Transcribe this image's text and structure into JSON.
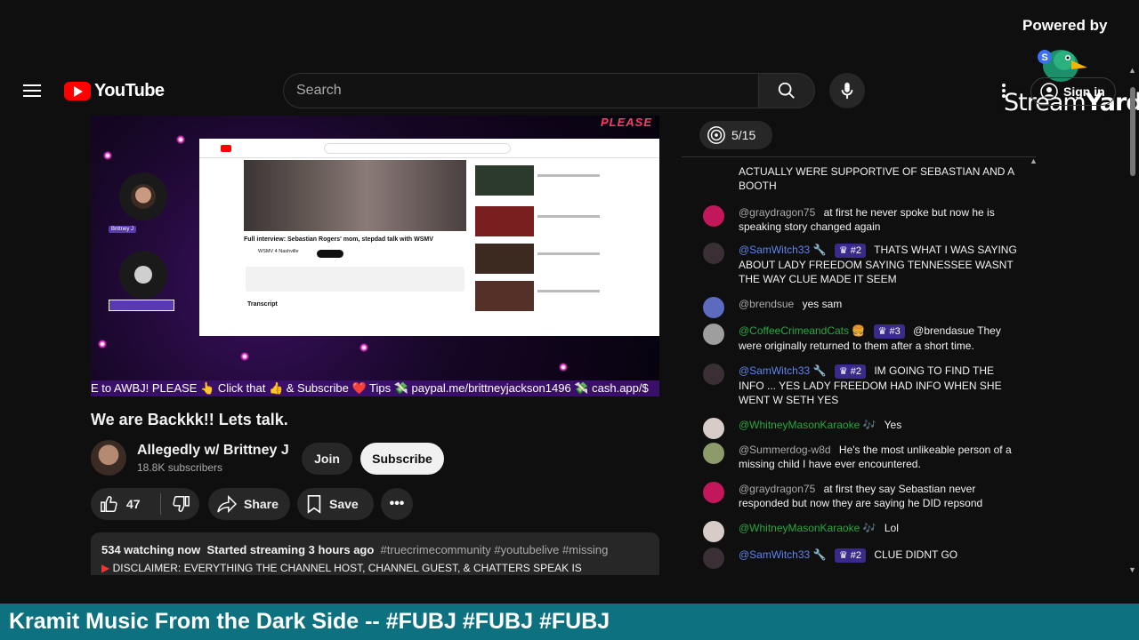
{
  "overlay": {
    "powered_by": "Powered by",
    "brand_stream": "Stream",
    "brand_yard": "Yard",
    "banner_text": "Kramit Music From the Dark Side -- #FUBJ #FUBJ #FUBJ"
  },
  "header": {
    "logo_text": "YouTube",
    "search_placeholder": "Search",
    "signin_label": "Sign in"
  },
  "video": {
    "please_text": "PLEASE",
    "ticker_text": "E to AWBJ! PLEASE 👆 Click that 👍 & Subscribe ❤️ Tips 💸 paypal.me/brittneyjackson1496 💸 cash.app/$",
    "inner_title": "Full interview: Sebastian Rogers' mom, stepdad talk with WSMV",
    "inner_channel": "WSMV 4 Nashville",
    "inner_transcript": "Transcript",
    "cam_label": "Brittney J"
  },
  "info": {
    "title": "We are Backkk!! Lets talk.",
    "channel_name": "Allegedly w/ Brittney J",
    "subscribers": "18.8K subscribers",
    "join_label": "Join",
    "subscribe_label": "Subscribe",
    "likes": "47",
    "share_label": "Share",
    "save_label": "Save",
    "watching": "534 watching now",
    "started": "Started streaming 3 hours ago",
    "hashtags": "#truecrimecommunity #youtubelive #missing",
    "disclaimer": "DISCLAIMER: EVERYTHING THE CHANNEL HOST, CHANNEL GUEST, & CHATTERS SPEAK IS"
  },
  "chat": {
    "counter": "5/15",
    "messages": [
      {
        "author": "",
        "badge": "",
        "text": "ACTUALLY WERE SUPPORTIVE OF SEBASTIAN AND A BOOTH",
        "color": "#aaa"
      },
      {
        "author": "@graydragon75",
        "badge": "",
        "text": "at first he never spoke but now he is speaking story changed again",
        "color": "#aaa"
      },
      {
        "author": "@SamWitch33 🔧",
        "badge": "♛ #2",
        "text": "THATS WHAT I WAS SAYING ABOUT LADY FREEDOM SAYING TENNESSEE WASNT THE WAY CLUE MADE IT SEEM",
        "color": "#5e84f1"
      },
      {
        "author": "@brendsue",
        "badge": "",
        "text": "yes sam",
        "color": "#aaa"
      },
      {
        "author": "@CoffeeCrimeandCats 🍔",
        "badge": "♛ #3",
        "text": "@brendasue They were originally returned to them after a short time.",
        "color": "#2ba640"
      },
      {
        "author": "@SamWitch33 🔧",
        "badge": "♛ #2",
        "text": "IM GOING TO FIND THE INFO ... YES LADY FREEDOM HAD INFO WHEN SHE WENT W SETH YES",
        "color": "#5e84f1"
      },
      {
        "author": "@WhitneyMasonKaraoke 🎶",
        "badge": "",
        "text": "Yes",
        "color": "#2ba640"
      },
      {
        "author": "@Summerdog-w8d",
        "badge": "",
        "text": "He's the most unlikeable person of a missing child I have ever encountered.",
        "color": "#aaa"
      },
      {
        "author": "@graydragon75",
        "badge": "",
        "text": "at first they say Sebastian never responded but now they are saying he DID repsond",
        "color": "#aaa"
      },
      {
        "author": "@WhitneyMasonKaraoke 🎶",
        "badge": "",
        "text": "Lol",
        "color": "#2ba640"
      },
      {
        "author": "@SamWitch33 🔧",
        "badge": "♛ #2",
        "text": "CLUE DIDNT GO",
        "color": "#5e84f1"
      }
    ]
  },
  "icons": {
    "menu": "hamburger-menu-icon",
    "search": "search-icon",
    "mic": "mic-icon",
    "like": "thumbs-up-icon",
    "dislike": "thumbs-down-icon",
    "share": "share-icon",
    "save": "bookmark-icon",
    "more": "more-icon",
    "target": "target-icon"
  }
}
